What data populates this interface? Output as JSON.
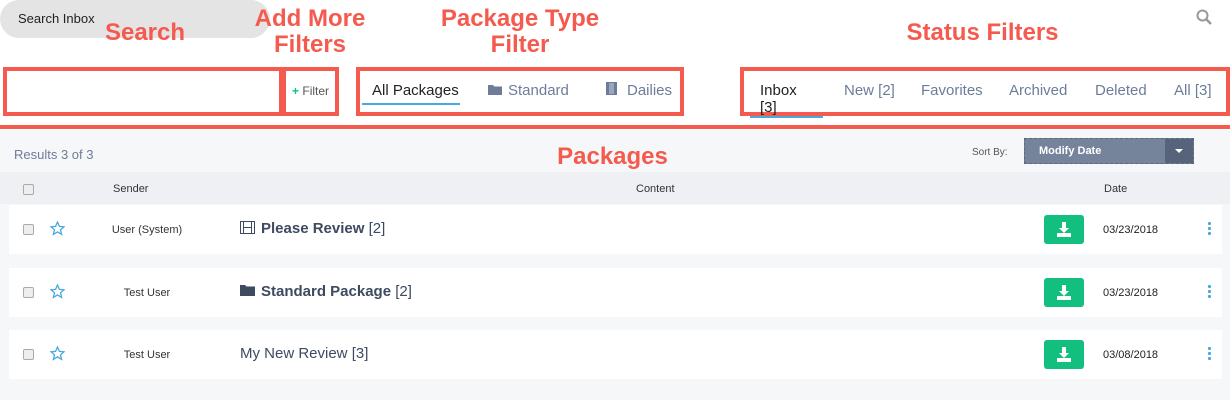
{
  "annotations": {
    "search": "Search",
    "filters_l1": "Add More",
    "filters_l2": "Filters",
    "pkg_l1": "Package Type",
    "pkg_l2": "Filter",
    "status": "Status Filters",
    "packages": "Packages"
  },
  "search": {
    "placeholder": "Search Inbox"
  },
  "filter_button": {
    "plus": "+",
    "label": "Filter"
  },
  "package_tabs": [
    {
      "label": "All Packages"
    },
    {
      "label": "Standard"
    },
    {
      "label": "Dailies"
    }
  ],
  "status_tabs": [
    {
      "label": "Inbox [3]"
    },
    {
      "label": "New [2]"
    },
    {
      "label": "Favorites"
    },
    {
      "label": "Archived"
    },
    {
      "label": "Deleted"
    },
    {
      "label": "All [3]"
    }
  ],
  "results": "Results 3 of 3",
  "sort": {
    "label": "Sort By:",
    "value": "Modify Date"
  },
  "columns": {
    "sender": "Sender",
    "content": "Content",
    "date": "Date"
  },
  "rows": [
    {
      "sender": "User (System)",
      "title": "Please Review",
      "count": "[2]",
      "icon": "film-icon",
      "bold": true,
      "date": "03/23/2018"
    },
    {
      "sender": "Test User",
      "title": "Standard Package",
      "count": "[2]",
      "icon": "folder-icon",
      "bold": true,
      "date": "03/23/2018"
    },
    {
      "sender": "Test User",
      "title": "My New Review",
      "count": "[3]",
      "icon": "none",
      "bold": false,
      "date": "03/08/2018"
    }
  ],
  "colors": {
    "annotation": "#f55a4e",
    "accent": "#4aa8e0",
    "download": "#13bf7f",
    "sort_bg": "#76849b"
  }
}
